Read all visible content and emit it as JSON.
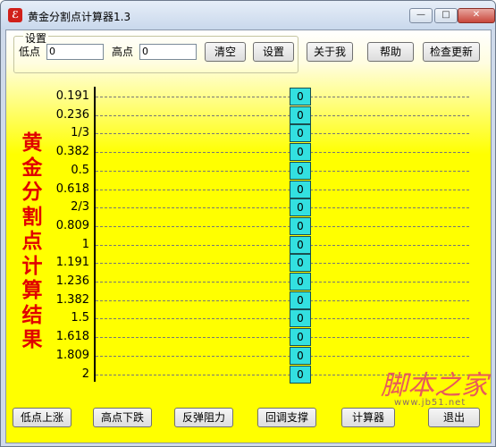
{
  "window": {
    "title": "黄金分割点计算器1.3",
    "controls": {
      "minimize": "—",
      "maximize": "□",
      "close": "✕"
    }
  },
  "settings": {
    "group_title": "设置",
    "low_label": "低点",
    "low_value": "0",
    "high_label": "高点",
    "high_value": "0",
    "clear_button": "清空",
    "settings_button": "设置"
  },
  "toolbar": {
    "about_button": "关于我",
    "help_button": "帮助",
    "update_button": "检查更新"
  },
  "results": {
    "title_chars": [
      "黄",
      "金",
      "分",
      "割",
      "点",
      "计",
      "算",
      "结",
      "果"
    ],
    "rows": [
      {
        "ratio": "0.191",
        "value": "0"
      },
      {
        "ratio": "0.236",
        "value": "0"
      },
      {
        "ratio": "1/3",
        "value": "0"
      },
      {
        "ratio": "0.382",
        "value": "0"
      },
      {
        "ratio": "0.5",
        "value": "0"
      },
      {
        "ratio": "0.618",
        "value": "0"
      },
      {
        "ratio": "2/3",
        "value": "0"
      },
      {
        "ratio": "0.809",
        "value": "0"
      },
      {
        "ratio": "1",
        "value": "0"
      },
      {
        "ratio": "1.191",
        "value": "0"
      },
      {
        "ratio": "1.236",
        "value": "0"
      },
      {
        "ratio": "1.382",
        "value": "0"
      },
      {
        "ratio": "1.5",
        "value": "0"
      },
      {
        "ratio": "1.618",
        "value": "0"
      },
      {
        "ratio": "1.809",
        "value": "0"
      },
      {
        "ratio": "2",
        "value": "0"
      }
    ]
  },
  "bottom_buttons": {
    "low_rise": "低点上涨",
    "high_fall": "高点下跌",
    "rebound_resistance": "反弹阻力",
    "pullback_support": "回调支撑",
    "calculate": "计算器",
    "exit": "退出"
  },
  "watermark": {
    "text": "脚本之家",
    "url": "www.jb51.net"
  }
}
